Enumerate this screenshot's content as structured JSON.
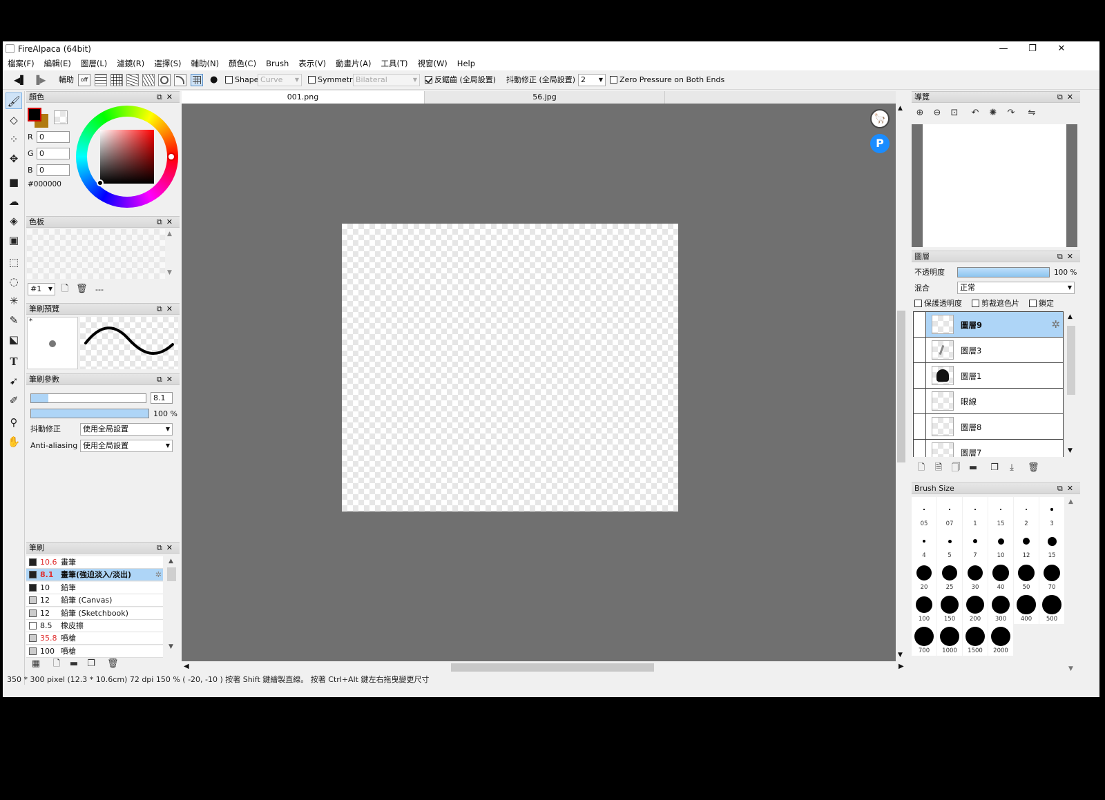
{
  "window": {
    "title": "FireAlpaca (64bit)",
    "minimize": "—",
    "restore": "❐",
    "close": "✕"
  },
  "menu": [
    "檔案(F)",
    "編輯(E)",
    "圖層(L)",
    "濾鏡(R)",
    "選擇(S)",
    "輔助(N)",
    "顏色(C)",
    "Brush",
    "表示(V)",
    "動畫片(A)",
    "工具(T)",
    "視窗(W)",
    "Help"
  ],
  "toolbar": {
    "assist_label": "輔助",
    "shape_label": "Shape",
    "shape_value": "Curve",
    "symmetry_label": "Symmetry",
    "symmetry_value": "Bilateral",
    "antialias_label": "反鋸齒 (全局設置)",
    "antialias_checked": true,
    "stabilizer_label": "抖動修正 (全局設置)",
    "stabilizer_value": "2",
    "zero_pressure_label": "Zero Pressure on Both Ends"
  },
  "color_panel": {
    "title": "顏色",
    "r_label": "R",
    "g_label": "G",
    "b_label": "B",
    "r": "0",
    "g": "0",
    "b": "0",
    "hex": "#000000"
  },
  "palette_panel": {
    "title": "色板",
    "palette_select": "#1",
    "more": "---"
  },
  "brush_preview_panel": {
    "title": "筆刷預覽",
    "mark": "*"
  },
  "brush_params_panel": {
    "title": "筆刷參數",
    "size_value": "8.1",
    "size_fraction": 0.15,
    "opacity_value": "100 %",
    "opacity_fraction": 1.0,
    "stabilizer_label": "抖動修正",
    "stabilizer_value": "使用全局設置",
    "antialias_label": "Anti-aliasing",
    "antialias_value": "使用全局設置"
  },
  "brush_panel": {
    "title": "筆刷",
    "items": [
      {
        "size": "10.6",
        "name": "畫筆",
        "red": true,
        "swatch": "#222222"
      },
      {
        "size": "8.1",
        "name": "畫筆(強迫淡入/淡出)",
        "red": true,
        "swatch": "#222222",
        "selected": true
      },
      {
        "size": "10",
        "name": "鉛筆",
        "red": false,
        "swatch": "#222222"
      },
      {
        "size": "12",
        "name": "鉛筆 (Canvas)",
        "red": false,
        "swatch": "#cccccc"
      },
      {
        "size": "12",
        "name": "鉛筆 (Sketchbook)",
        "red": false,
        "swatch": "#cccccc"
      },
      {
        "size": "8.5",
        "name": "橡皮擦",
        "red": false,
        "swatch": "#ffffff"
      },
      {
        "size": "35.8",
        "name": "噴槍",
        "red": true,
        "swatch": "#cccccc"
      },
      {
        "size": "100",
        "name": "噴槍",
        "red": false,
        "swatch": "#cccccc"
      }
    ]
  },
  "tabs": [
    "001.png",
    "56.jpg"
  ],
  "navigator_panel": {
    "title": "導覽"
  },
  "layers_panel": {
    "title": "圖層",
    "opacity_label": "不透明度",
    "opacity_value": "100 %",
    "opacity_fraction": 1.0,
    "blend_label": "混合",
    "blend_value": "正常",
    "protect_alpha": "保護透明度",
    "clipping": "剪裁遮色片",
    "lock": "鎖定",
    "layers": [
      {
        "name": "圖層9",
        "selected": true,
        "thumb": "empty"
      },
      {
        "name": "圖層3",
        "selected": false,
        "thumb": "sketch"
      },
      {
        "name": "圖層1",
        "selected": false,
        "thumb": "hair"
      },
      {
        "name": "眼線",
        "selected": false,
        "thumb": "empty"
      },
      {
        "name": "圖層8",
        "selected": false,
        "thumb": "empty"
      },
      {
        "name": "圖層7",
        "selected": false,
        "thumb": "empty"
      }
    ]
  },
  "brush_size_panel": {
    "title": "Brush Size",
    "sizes": [
      "0.5",
      "0.7",
      "1",
      "1.5",
      "2",
      "3",
      "4",
      "5",
      "7",
      "10",
      "12",
      "15",
      "20",
      "25",
      "30",
      "40",
      "50",
      "70",
      "100",
      "150",
      "200",
      "300",
      "400",
      "500",
      "700",
      "1000",
      "1500",
      "2000"
    ],
    "display_labels": [
      "05",
      "07",
      "1",
      "15",
      "2",
      "3",
      "4",
      "5",
      "7",
      "10",
      "12",
      "15",
      "20",
      "25",
      "30",
      "40",
      "50",
      "70",
      "100",
      "150",
      "200",
      "300",
      "400",
      "500",
      "700",
      "1000",
      "1500",
      "2000"
    ]
  },
  "status": "350 * 300 pixel   (12.3 * 10.6cm)   72 dpi   150 %   ( -20, -10 )   按著 Shift 鍵繪製直線。 按著 Ctrl+Alt 鍵左右拖曳變更尺寸",
  "colors": {
    "accent": "#aed5f7",
    "canvas_bg": "#707070",
    "panel_bg": "#f0f0f0"
  }
}
